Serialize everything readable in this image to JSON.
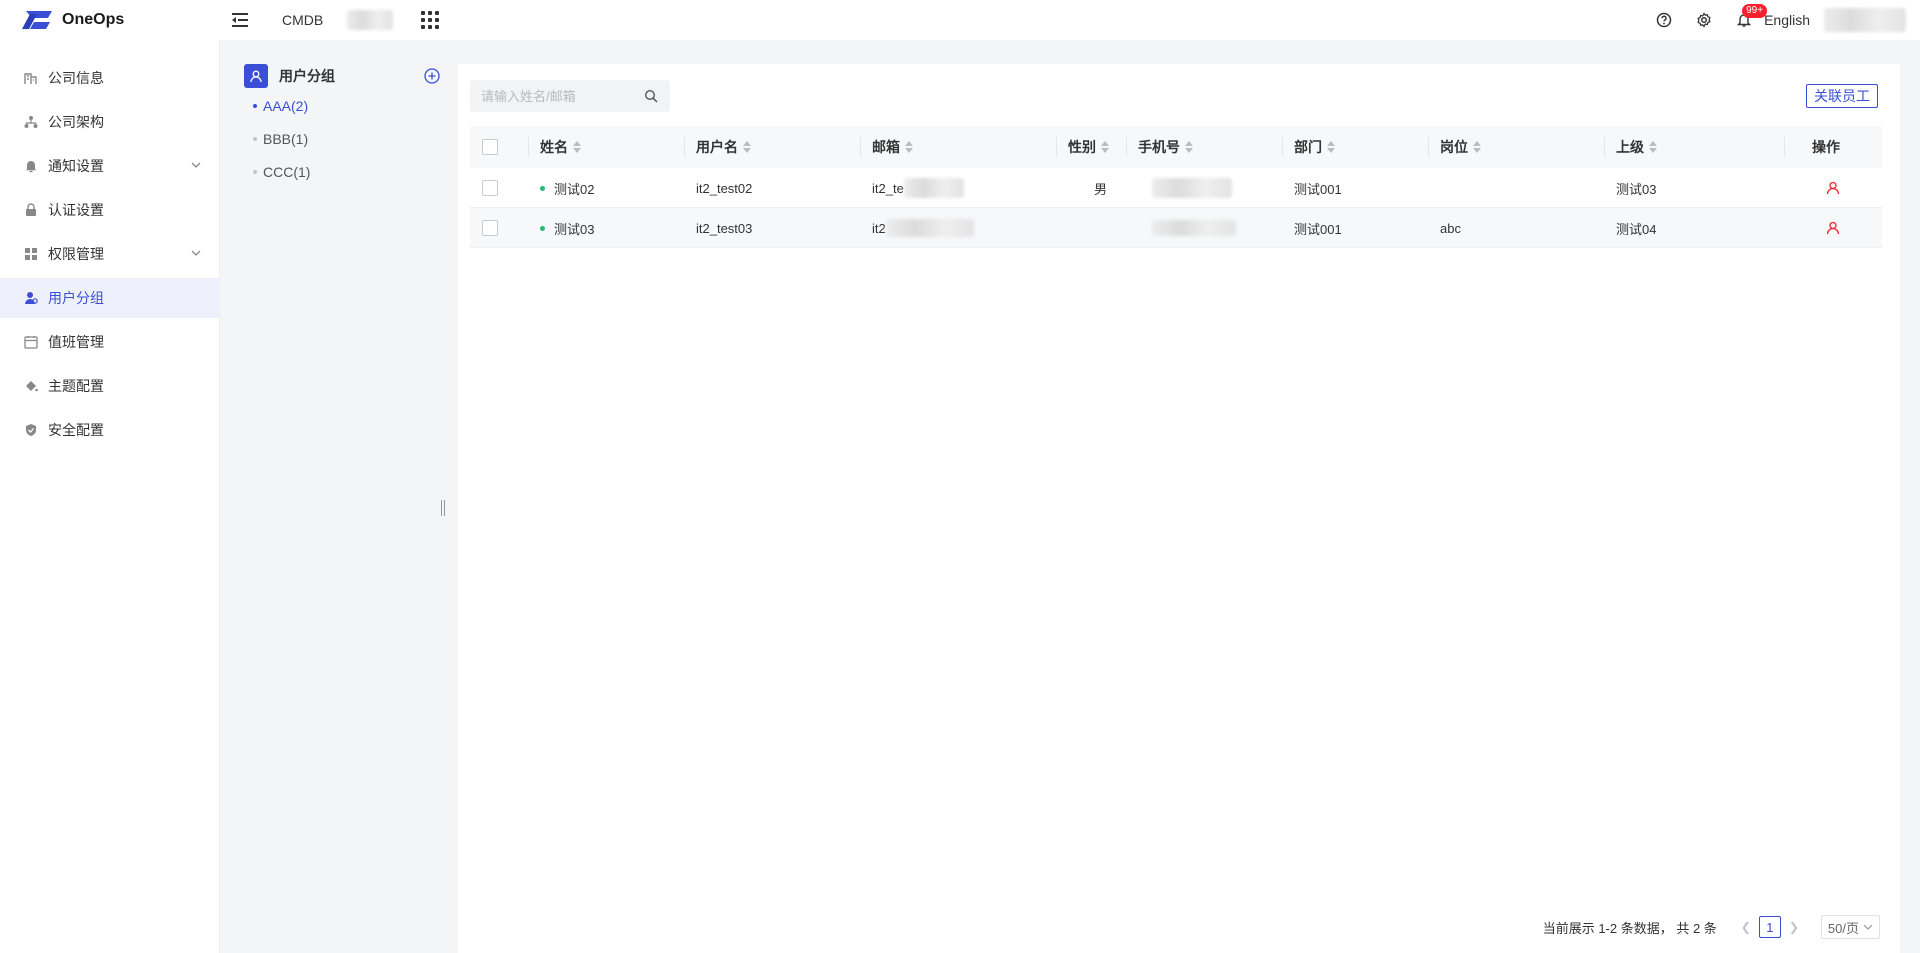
{
  "header": {
    "logo_text": "OneOps",
    "nav_app": "CMDB",
    "language": "English",
    "notification_badge": "99+"
  },
  "sidebar": {
    "items": [
      {
        "label": "公司信息",
        "icon": "building-icon"
      },
      {
        "label": "公司架构",
        "icon": "org-chart-icon"
      },
      {
        "label": "通知设置",
        "icon": "bell-icon",
        "expandable": true
      },
      {
        "label": "认证设置",
        "icon": "lock-icon"
      },
      {
        "label": "权限管理",
        "icon": "grid-icon",
        "expandable": true
      },
      {
        "label": "用户分组",
        "icon": "user-group-icon",
        "active": true
      },
      {
        "label": "值班管理",
        "icon": "calendar-icon"
      },
      {
        "label": "主题配置",
        "icon": "paint-bucket-icon"
      },
      {
        "label": "安全配置",
        "icon": "shield-icon"
      }
    ]
  },
  "groups": {
    "title": "用户分组",
    "items": [
      {
        "label": "AAA(2)",
        "active": true
      },
      {
        "label": "BBB(1)"
      },
      {
        "label": "CCC(1)"
      }
    ]
  },
  "toolbar": {
    "search_placeholder": "请输入姓名/邮箱",
    "link_button": "关联员工"
  },
  "table": {
    "columns": [
      "姓名",
      "用户名",
      "邮箱",
      "性别",
      "手机号",
      "部门",
      "岗位",
      "上级",
      "操作"
    ],
    "rows": [
      {
        "name": "测试02",
        "username": "it2_test02",
        "email": "it2_te",
        "gender": "男",
        "phone": "",
        "department": "测试001",
        "position": "",
        "superior": "测试03"
      },
      {
        "name": "测试03",
        "username": "it2_test03",
        "email": "it2",
        "gender": "",
        "phone": "",
        "department": "测试001",
        "position": "abc",
        "superior": "测试04"
      }
    ]
  },
  "pagination": {
    "total_text": "当前展示 1-2 条数据， 共 2 条",
    "current_page": "1",
    "page_size": "50/页"
  },
  "colors": {
    "primary": "#3a4fd6",
    "danger": "#f5222d",
    "status_active": "#2bb673"
  }
}
